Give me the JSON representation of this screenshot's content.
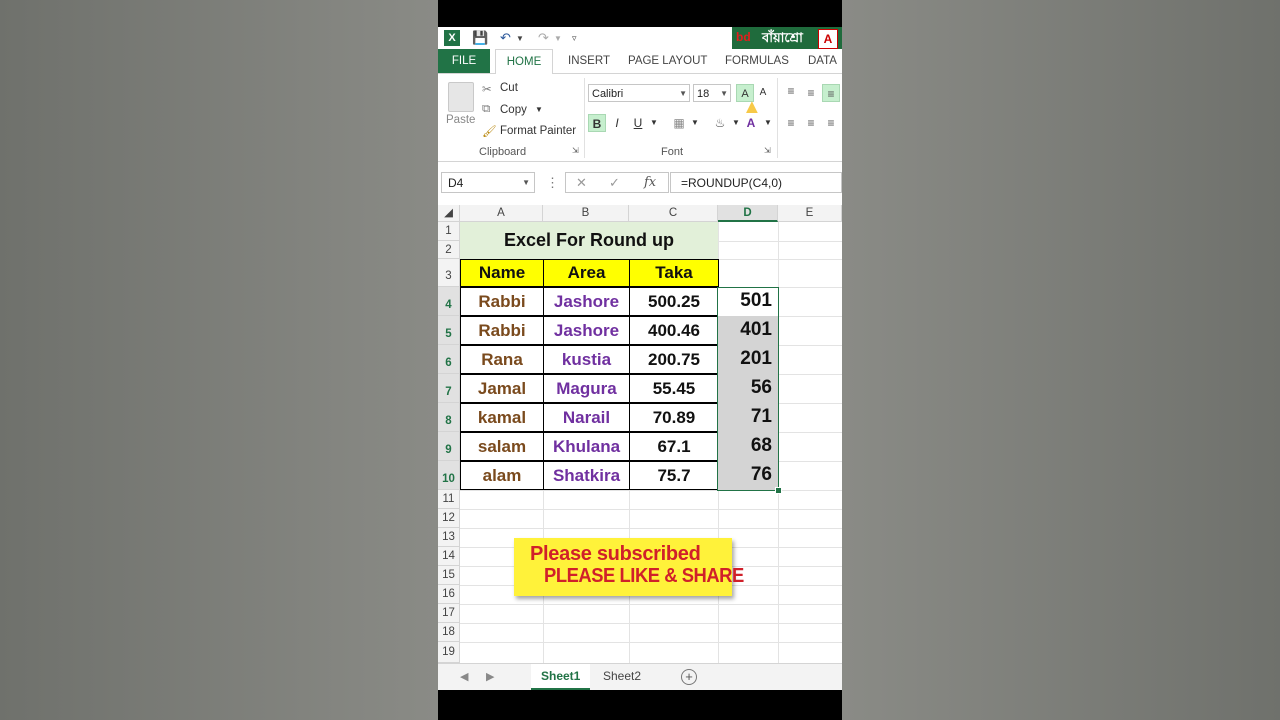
{
  "app": {
    "brand_text": "বাঁয়াশ্রো",
    "logo_text": "bd"
  },
  "tabs": [
    {
      "label": "FILE"
    },
    {
      "label": "HOME"
    },
    {
      "label": "INSERT"
    },
    {
      "label": "PAGE LAYOUT"
    },
    {
      "label": "FORMULAS"
    },
    {
      "label": "DATA"
    }
  ],
  "ribbon": {
    "clipboard": {
      "paste_label": "Paste",
      "cut_label": "Cut",
      "copy_label": "Copy",
      "format_painter_label": "Format Painter",
      "group_label": "Clipboard"
    },
    "font": {
      "font_name": "Calibri",
      "font_size": "18",
      "bold": "B",
      "italic": "I",
      "underline": "U",
      "group_label": "Font"
    }
  },
  "formula_bar": {
    "name_box": "D4",
    "formula": "=ROUNDUP(C4,0)"
  },
  "columns": [
    "A",
    "B",
    "C",
    "D",
    "E"
  ],
  "rows": [
    "1",
    "2",
    "3",
    "4",
    "5",
    "6",
    "7",
    "8",
    "9",
    "10",
    "11",
    "12",
    "13",
    "14",
    "15",
    "16",
    "17",
    "18",
    "19"
  ],
  "sheet": {
    "title": "Excel For Round up",
    "headers": [
      "Name",
      "Area",
      "Taka"
    ],
    "records": [
      {
        "name": "Rabbi",
        "area": "Jashore",
        "taka": "500.25",
        "rounded": "501"
      },
      {
        "name": "Rabbi",
        "area": "Jashore",
        "taka": "400.46",
        "rounded": "401"
      },
      {
        "name": "Rana",
        "area": "kustia",
        "taka": "200.75",
        "rounded": "201"
      },
      {
        "name": "Jamal",
        "area": "Magura",
        "taka": "55.45",
        "rounded": "56"
      },
      {
        "name": "kamal",
        "area": "Narail",
        "taka": "70.89",
        "rounded": "71"
      },
      {
        "name": "salam",
        "area": "Khulana",
        "taka": "67.1",
        "rounded": "68"
      },
      {
        "name": "alam",
        "area": "Shatkira",
        "taka": "75.7",
        "rounded": "76"
      }
    ]
  },
  "banner": {
    "line1": "Please subscribed",
    "line2": "PLEASE LIKE & SHARE"
  },
  "sheet_tabs": [
    {
      "label": "Sheet1"
    },
    {
      "label": "Sheet2"
    }
  ],
  "colors": {
    "excel_green": "#217346",
    "header_yellow": "#ffff00",
    "title_green": "#e2f0d9",
    "name_brown": "#7a4a1d",
    "area_purple": "#7030a0",
    "banner_red": "#d0202a"
  }
}
